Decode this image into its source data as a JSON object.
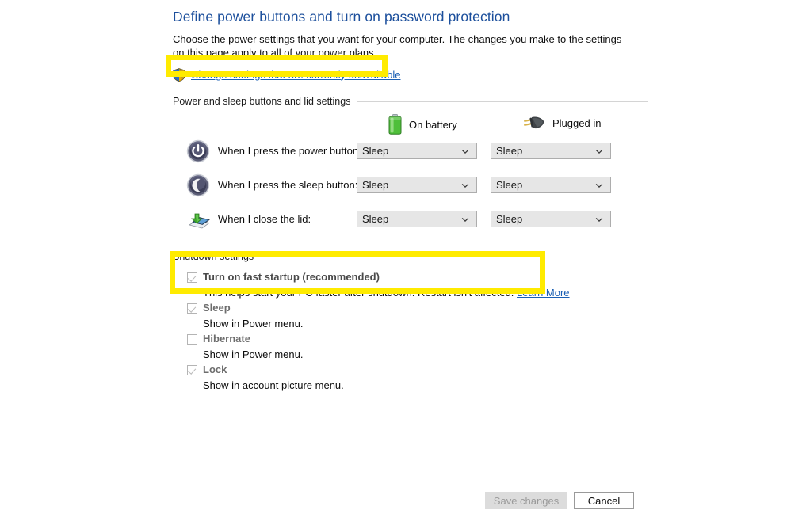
{
  "page": {
    "title": "Define power buttons and turn on password protection",
    "description": "Choose the power settings that you want for your computer. The changes you make to the settings on this page apply to all of your power plans.",
    "uac_link": "Change settings that are currently unavailable"
  },
  "power_sleep_group": {
    "header": "Power and sleep buttons and lid settings",
    "columns": [
      {
        "label": "On battery",
        "icon": "battery-icon"
      },
      {
        "label": "Plugged in",
        "icon": "power-plug-icon"
      }
    ],
    "rows": [
      {
        "icon": "power-button-icon",
        "label": "When I press the power button:",
        "on_battery": "Sleep",
        "plugged_in": "Sleep"
      },
      {
        "icon": "sleep-button-icon",
        "label": "When I press the sleep button:",
        "on_battery": "Sleep",
        "plugged_in": "Sleep"
      },
      {
        "icon": "close-lid-icon",
        "label": "When I close the lid:",
        "on_battery": "Sleep",
        "plugged_in": "Sleep"
      }
    ]
  },
  "shutdown_group": {
    "header": "Shutdown settings",
    "items": [
      {
        "label": "Turn on fast startup (recommended)",
        "description": "This helps start your PC faster after shutdown. Restart isn't affected.",
        "link": "Learn More",
        "checked": true,
        "disabled": true
      },
      {
        "label": "Sleep",
        "description": "Show in Power menu.",
        "link": "",
        "checked": true,
        "disabled": true
      },
      {
        "label": "Hibernate",
        "description": "Show in Power menu.",
        "link": "",
        "checked": false,
        "disabled": true
      },
      {
        "label": "Lock",
        "description": "Show in account picture menu.",
        "link": "",
        "checked": true,
        "disabled": true
      }
    ]
  },
  "footer": {
    "save_label": "Save changes",
    "cancel_label": "Cancel"
  },
  "highlights": {
    "color": "#ffeb00",
    "regions": [
      "uac-link",
      "fast-startup-setting"
    ]
  }
}
